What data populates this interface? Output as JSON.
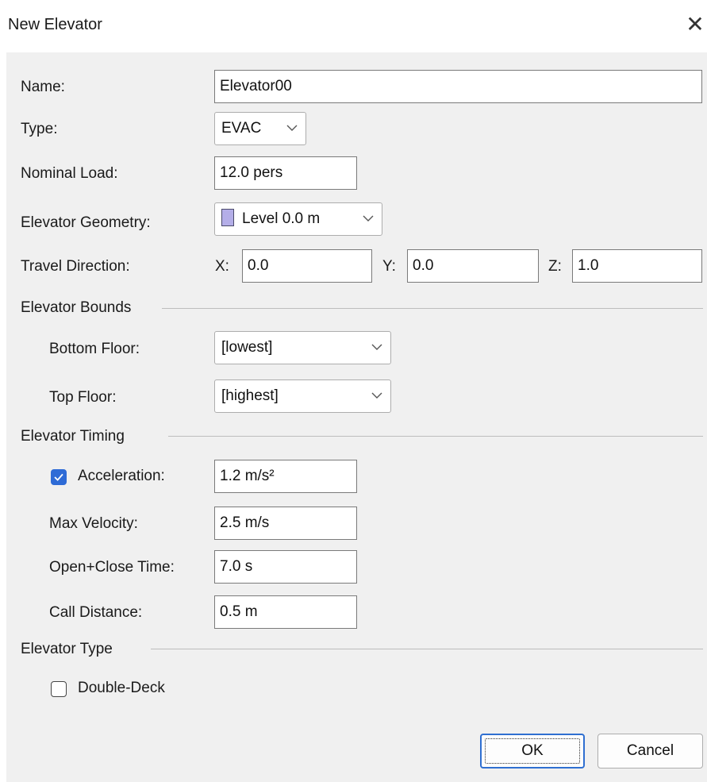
{
  "window": {
    "title": "New Elevator",
    "close_glyph": "✕"
  },
  "form": {
    "name_label": "Name:",
    "name_value": "Elevator00",
    "type_label": "Type:",
    "type_value": "EVAC",
    "load_label": "Nominal Load:",
    "load_value": "12.0 pers",
    "geometry_label": "Elevator Geometry:",
    "geometry_value": "Level 0.0 m",
    "direction_label": "Travel Direction:",
    "x_label": "X:",
    "x_value": "0.0",
    "y_label": "Y:",
    "y_value": "0.0",
    "z_label": "Z:",
    "z_value": "1.0"
  },
  "bounds": {
    "heading": "Elevator Bounds",
    "bottom_label": "Bottom Floor:",
    "bottom_value": "[lowest]",
    "top_label": "Top Floor:",
    "top_value": "[highest]"
  },
  "timing": {
    "heading": "Elevator Timing",
    "acceleration_label": "Acceleration:",
    "acceleration_checked": true,
    "acceleration_value": "1.2 m/s²",
    "velocity_label": "Max Velocity:",
    "velocity_value": "2.5 m/s",
    "openclose_label": "Open+Close Time:",
    "openclose_value": "7.0 s",
    "call_label": "Call Distance:",
    "call_value": "0.5 m"
  },
  "type_group": {
    "heading": "Elevator Type",
    "double_deck_label": "Double-Deck",
    "double_deck_checked": false
  },
  "buttons": {
    "ok": "OK",
    "cancel": "Cancel"
  },
  "colors": {
    "accent": "#2e6bd6",
    "geometry_swatch": "#b4aee8",
    "dialog_bg": "#f0f0f0"
  }
}
